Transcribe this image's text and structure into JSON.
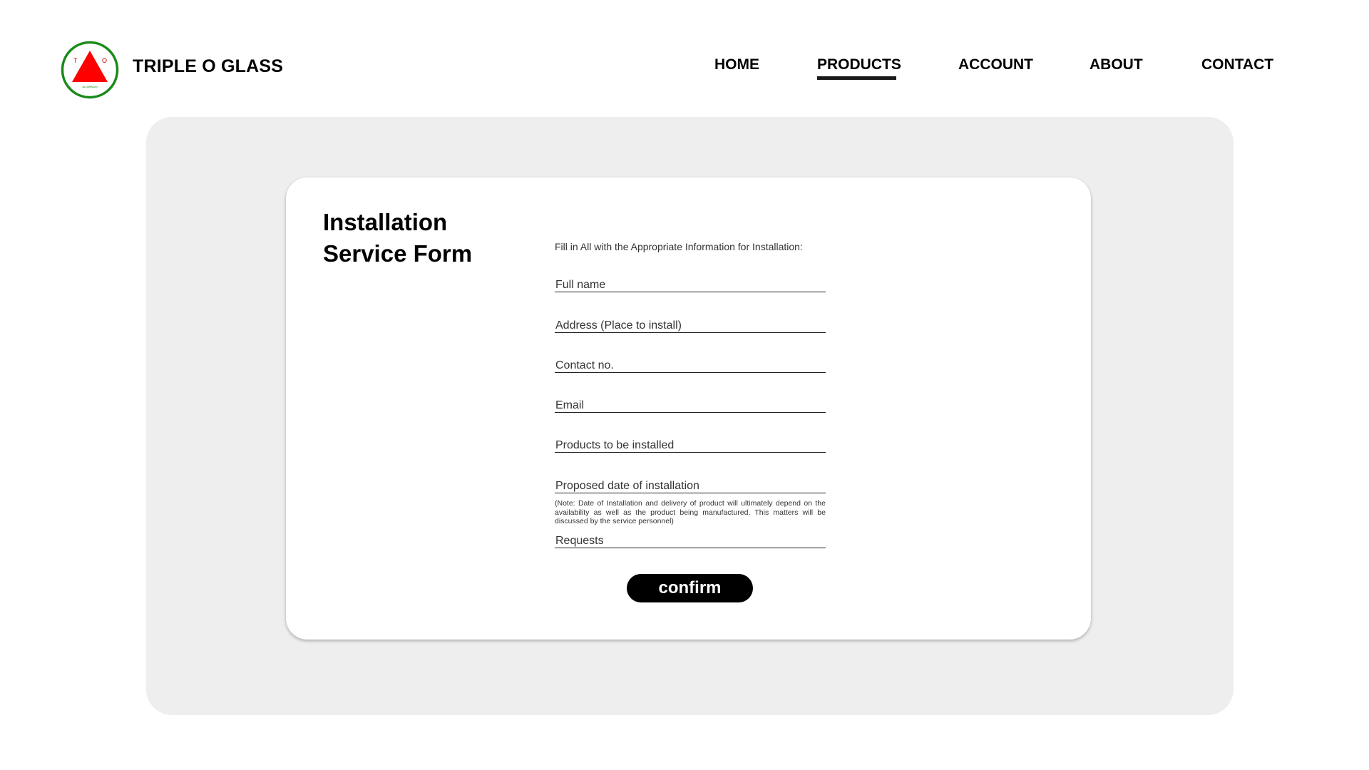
{
  "header": {
    "brand_name": "TRIPLE O GLASS",
    "logo": {
      "letter_left": "T",
      "letter_right": "O",
      "subtext": "ALUMINUM",
      "ring_color": "#1a8a1a",
      "triangle_color": "#ff0000"
    }
  },
  "nav": {
    "items": [
      {
        "label": "HOME"
      },
      {
        "label": "PRODUCTS",
        "active": true
      },
      {
        "label": "ACCOUNT"
      },
      {
        "label": "ABOUT"
      },
      {
        "label": "CONTACT"
      }
    ]
  },
  "form": {
    "title_line1": "Installation",
    "title_line2": "Service Form",
    "instructions": "Fill in All with the Appropriate Information for Installation:",
    "fields": {
      "full_name": "Full name",
      "address": "Address (Place to install)",
      "contact": "Contact no.",
      "email": "Email",
      "products": "Products to be installed",
      "date": "Proposed date of installation",
      "requests": "Requests"
    },
    "note": "(Note: Date of Installation and delivery of product will ultimately depend on the availability as well as the product being manufactured. This matters will be discussed by the service personnel)",
    "confirm_label": "confirm"
  },
  "colors": {
    "panel_background": "#eeeeee",
    "card_background": "#ffffff",
    "button_background": "#000000",
    "button_text": "#ffffff"
  }
}
